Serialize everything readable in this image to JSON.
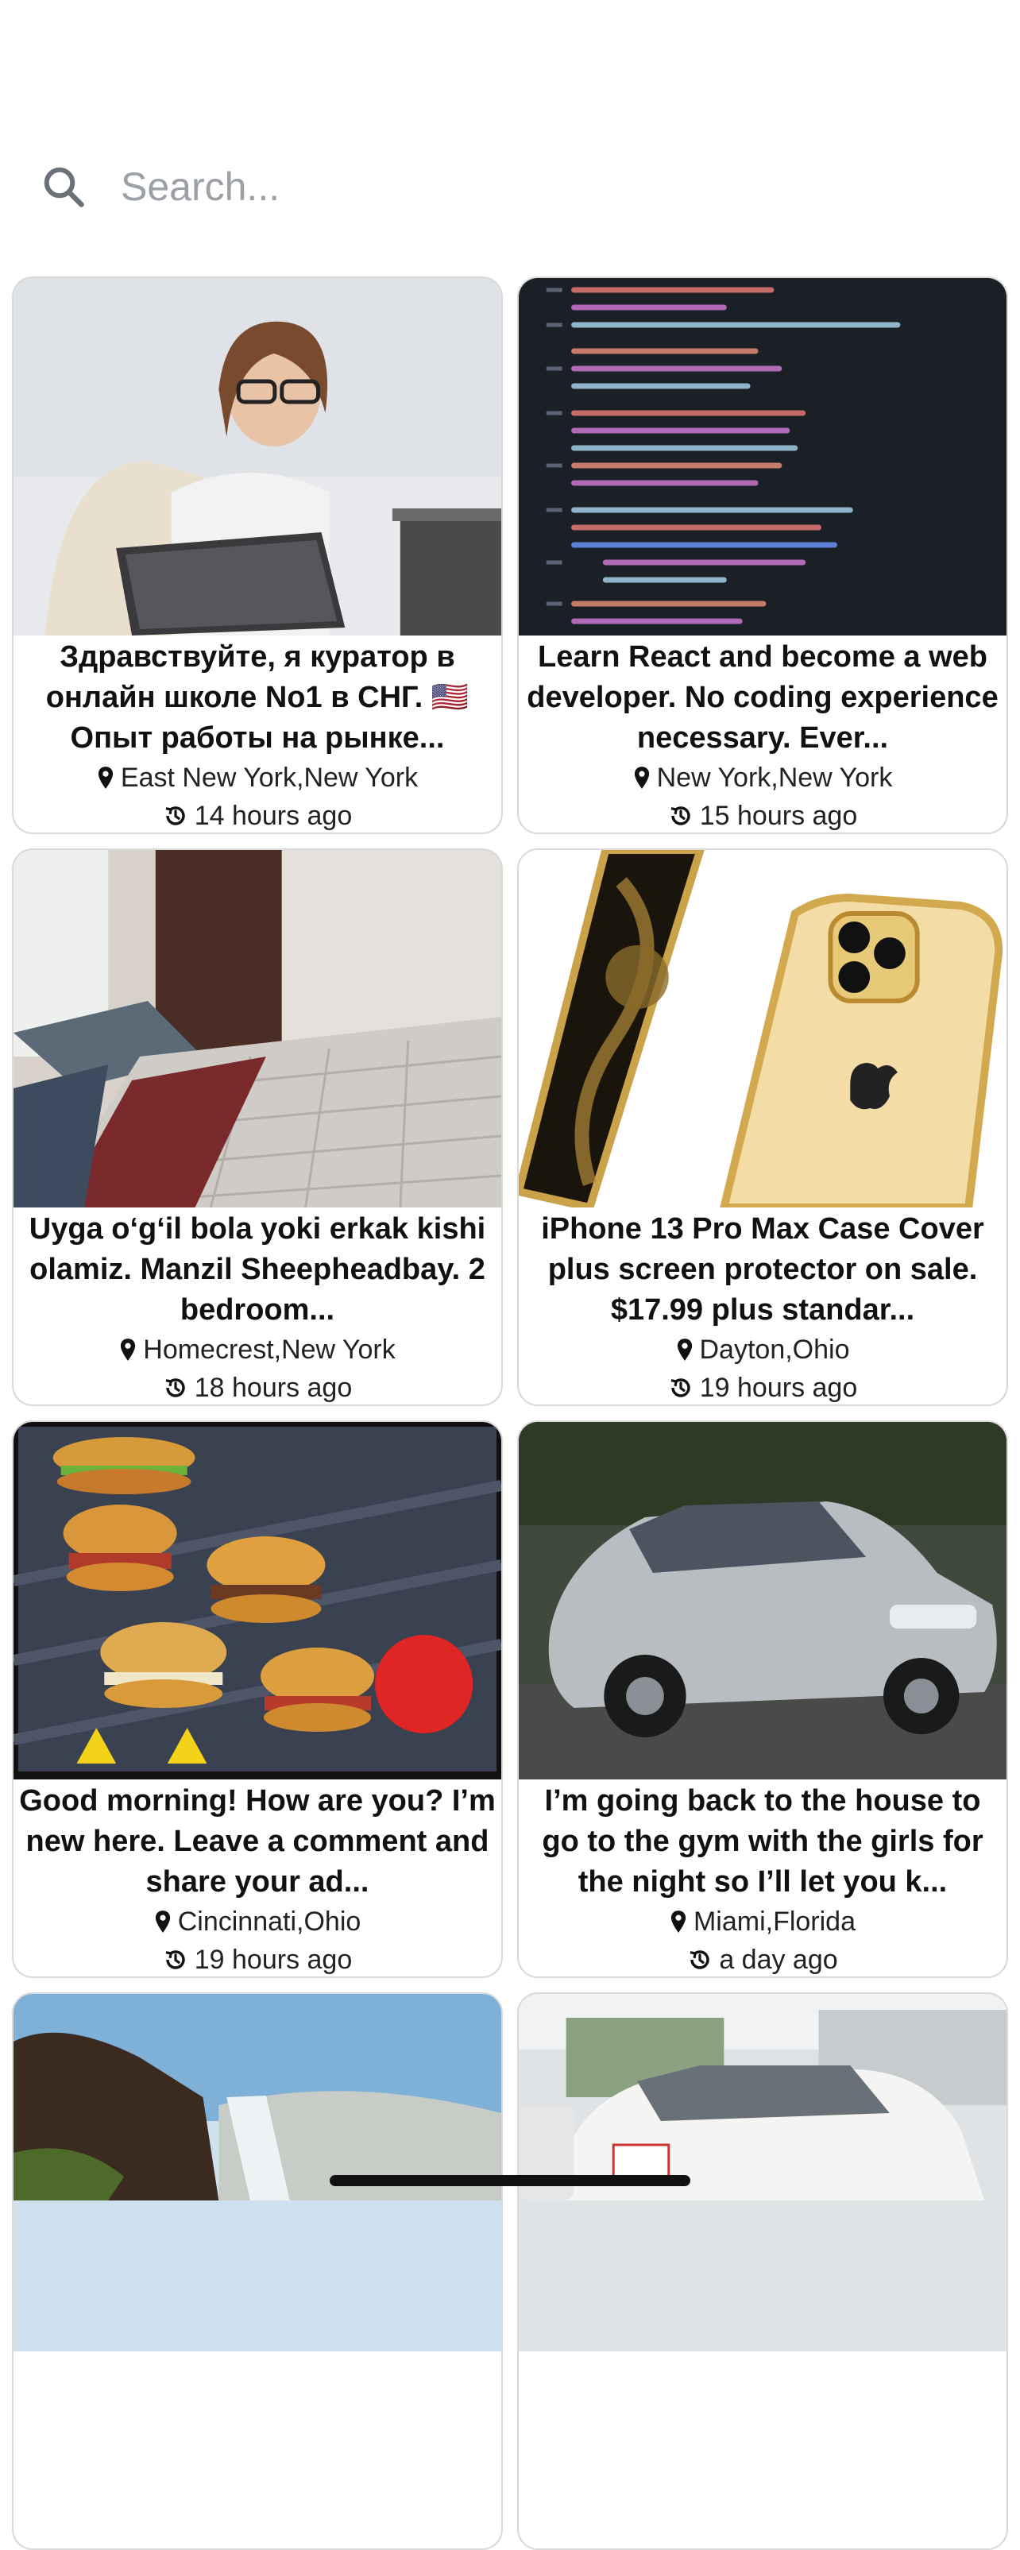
{
  "search": {
    "placeholder": "Search..."
  },
  "listings": [
    {
      "title": "Здравствуйте, я куратор в онлайн школе No1 в СНГ. 🇺🇸 Опыт работы на рынке...",
      "location": "East New York,New York",
      "time": "14 hours ago",
      "image": "woman-with-tablet"
    },
    {
      "title": "Learn React and become a web developer. No coding experience necessary. Ever...",
      "location": "New York,New York",
      "time": "15 hours ago",
      "image": "code-on-screen"
    },
    {
      "title": "Uyga o‘g‘il bola yoki erkak kishi olamiz. Manzil Sheepheadbay. 2 bedroom...",
      "location": "Homecrest,New York",
      "time": "18 hours ago",
      "image": "bedroom-mattress"
    },
    {
      "title": "iPhone 13 Pro Max Case Cover plus screen protector on sale. $17.99 plus standar...",
      "location": "Dayton,Ohio",
      "time": "19 hours ago",
      "image": "gold-phone-case"
    },
    {
      "title": "Good morning! How are you? I’m new here. Leave a comment and share your ad...",
      "location": "Cincinnati,Ohio",
      "time": "19 hours ago",
      "image": "sandwich-menu"
    },
    {
      "title": "I’m going back to the house to go to the gym with the girls for the night so I’ll let you k...",
      "location": "Miami,Florida",
      "time": "a day ago",
      "image": "silver-sedan"
    },
    {
      "title": "",
      "location": "",
      "time": "",
      "image": "waterfall"
    },
    {
      "title": "",
      "location": "",
      "time": "",
      "image": "white-car"
    }
  ]
}
